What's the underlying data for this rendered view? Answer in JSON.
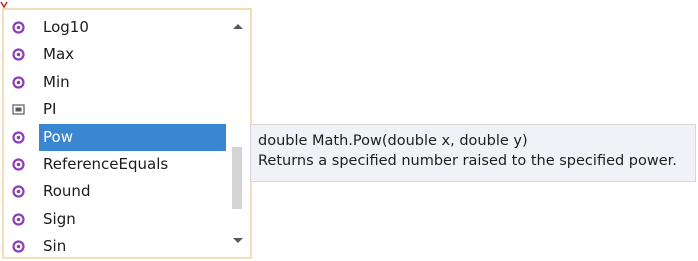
{
  "completion_list": {
    "items": [
      {
        "label": "Log10",
        "icon": "method-icon",
        "selected": false
      },
      {
        "label": "Max",
        "icon": "method-icon",
        "selected": false
      },
      {
        "label": "Min",
        "icon": "method-icon",
        "selected": false
      },
      {
        "label": "PI",
        "icon": "constant-icon",
        "selected": false
      },
      {
        "label": "Pow",
        "icon": "method-icon",
        "selected": true
      },
      {
        "label": "ReferenceEquals",
        "icon": "method-icon",
        "selected": false
      },
      {
        "label": "Round",
        "icon": "method-icon",
        "selected": false
      },
      {
        "label": "Sign",
        "icon": "method-icon",
        "selected": false
      },
      {
        "label": "Sin",
        "icon": "method-icon",
        "selected": false
      }
    ],
    "selected_color": "#3a86d1",
    "method_icon_color": "#8a3fb2",
    "border_color": "#f0dfb8",
    "scrollbar": {
      "up_icon": "chevron-up-icon",
      "down_icon": "chevron-down-icon"
    }
  },
  "tooltip": {
    "signature": "double Math.Pow(double x, double y)",
    "description": "Returns a specified number raised to the specified power."
  }
}
